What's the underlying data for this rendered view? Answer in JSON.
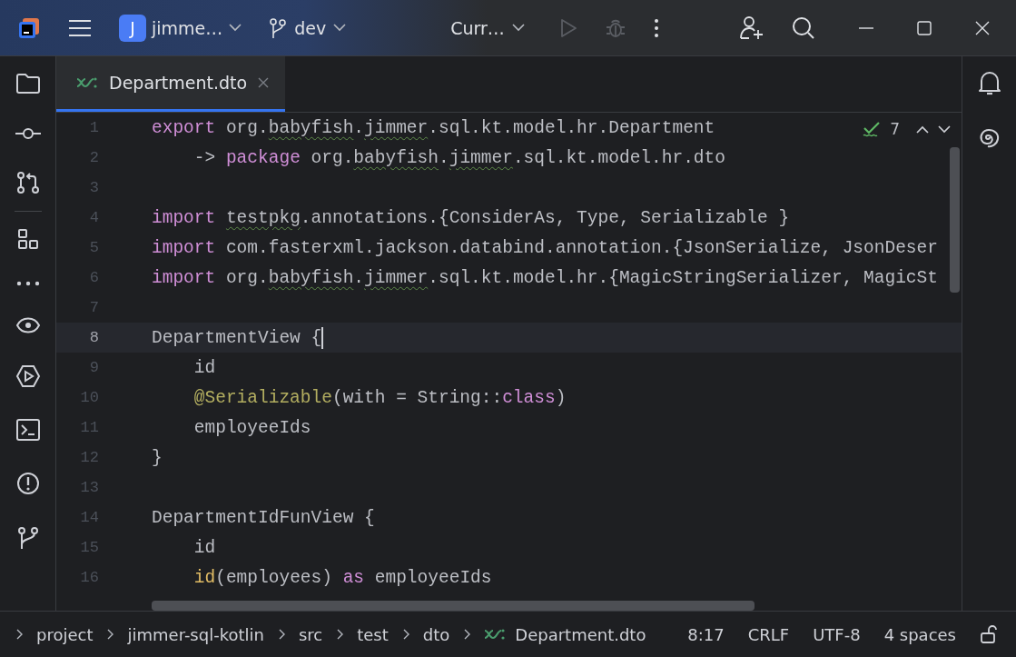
{
  "title_bar": {
    "project": {
      "initial": "J",
      "name": "jimme…"
    },
    "branch": "dev",
    "run_config": "Curr…",
    "run_enabled": false
  },
  "tabs": [
    {
      "label": "Department.dto",
      "selected": true
    }
  ],
  "editor": {
    "inspection_count": "7",
    "lines": [
      {
        "number": "1",
        "current": false,
        "tokens": [
          {
            "kind": "kw",
            "t": "export"
          },
          {
            "kind": "plain",
            "t": " org."
          },
          {
            "kind": "typo",
            "t": "babyfish"
          },
          {
            "kind": "plain",
            "t": "."
          },
          {
            "kind": "typo",
            "t": "jimmer"
          },
          {
            "kind": "plain",
            "t": ".sql.kt.model.hr.Department"
          }
        ]
      },
      {
        "number": "2",
        "current": false,
        "tokens": [
          {
            "kind": "plain",
            "t": "    -> "
          },
          {
            "kind": "kw",
            "t": "package"
          },
          {
            "kind": "plain",
            "t": " org."
          },
          {
            "kind": "typo",
            "t": "babyfish"
          },
          {
            "kind": "plain",
            "t": "."
          },
          {
            "kind": "typo",
            "t": "jimmer"
          },
          {
            "kind": "plain",
            "t": ".sql.kt.model.hr.dto"
          }
        ]
      },
      {
        "number": "3",
        "current": false
      },
      {
        "number": "4",
        "current": false,
        "tokens": [
          {
            "kind": "kw",
            "t": "import "
          },
          {
            "kind": "typo",
            "t": "testpkg"
          },
          {
            "kind": "plain",
            "t": ".annotations.{ConsiderAs, Type, Serializable }"
          }
        ]
      },
      {
        "number": "5",
        "current": false,
        "tokens": [
          {
            "kind": "kw",
            "t": "import"
          },
          {
            "kind": "plain",
            "t": " com.fasterxml.jackson.databind.annotation.{JsonSerialize, JsonDeser"
          }
        ]
      },
      {
        "number": "6",
        "current": false,
        "tokens": [
          {
            "kind": "kw",
            "t": "import"
          },
          {
            "kind": "plain",
            "t": " org."
          },
          {
            "kind": "typo",
            "t": "babyfish"
          },
          {
            "kind": "plain",
            "t": "."
          },
          {
            "kind": "typo",
            "t": "jimmer"
          },
          {
            "kind": "plain",
            "t": ".sql.kt.model.hr.{MagicStringSerializer, MagicSt"
          }
        ]
      },
      {
        "number": "7",
        "current": false
      },
      {
        "number": "8",
        "current": true,
        "tokens": [
          {
            "kind": "plain",
            "t": "DepartmentView {"
          }
        ]
      },
      {
        "number": "9",
        "current": false,
        "tokens": [
          {
            "kind": "plain",
            "t": "    id"
          }
        ]
      },
      {
        "number": "10",
        "current": false,
        "tokens": [
          {
            "kind": "ann",
            "t": "    @Serializable"
          },
          {
            "kind": "plain",
            "t": "(with = String::"
          },
          {
            "kind": "kw",
            "t": "class"
          },
          {
            "kind": "plain",
            "t": ")"
          }
        ]
      },
      {
        "number": "11",
        "current": false,
        "tokens": [
          {
            "kind": "plain",
            "t": "    employeeIds"
          }
        ]
      },
      {
        "number": "12",
        "current": false,
        "tokens": [
          {
            "kind": "plain",
            "t": "}"
          }
        ]
      },
      {
        "number": "13",
        "current": false
      },
      {
        "number": "14",
        "current": false,
        "tokens": [
          {
            "kind": "plain",
            "t": "DepartmentIdFunView {"
          }
        ]
      },
      {
        "number": "15",
        "current": false,
        "tokens": [
          {
            "kind": "plain",
            "t": "    id"
          }
        ]
      },
      {
        "number": "16",
        "current": false,
        "tokens": [
          {
            "kind": "call",
            "t": "    id"
          },
          {
            "kind": "plain",
            "t": "(employees) "
          },
          {
            "kind": "kw",
            "t": "as"
          },
          {
            "kind": "plain",
            "t": " employeeIds"
          }
        ]
      }
    ]
  },
  "status_bar": {
    "breadcrumbs": [
      {
        "label": "project",
        "kind": "folder"
      },
      {
        "label": "jimmer-sql-kotlin",
        "kind": "folder"
      },
      {
        "label": "src",
        "kind": "folder"
      },
      {
        "label": "test",
        "kind": "folder"
      },
      {
        "label": "dto",
        "kind": "folder"
      },
      {
        "label": "Department.dto",
        "kind": "file"
      }
    ],
    "position": "8:17",
    "line_separator": "CRLF",
    "encoding": "UTF-8",
    "indent": "4 spaces"
  }
}
